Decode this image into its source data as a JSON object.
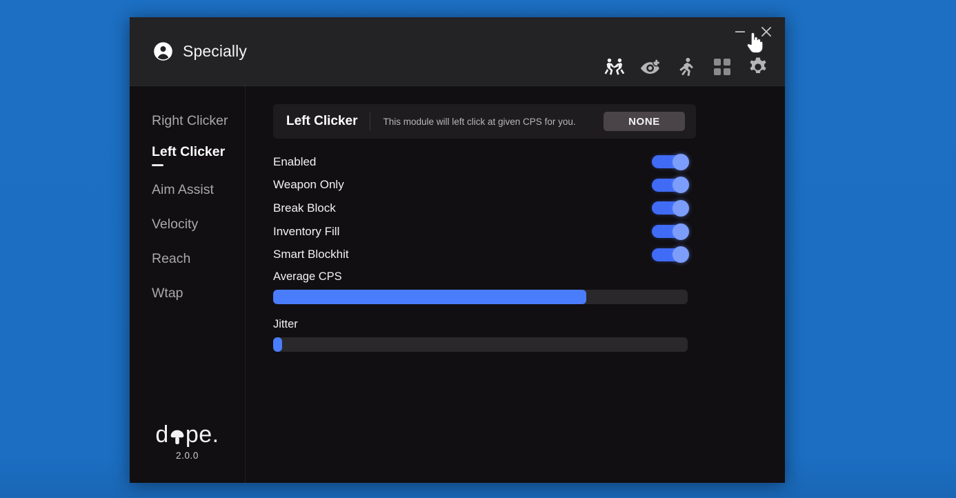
{
  "window": {
    "title": "Specially",
    "avatar_icon": "user-circle-icon",
    "minimize_label": "−",
    "close_label": "✕"
  },
  "nav_icons": [
    {
      "name": "combat-icon",
      "label": "Combat"
    },
    {
      "name": "eye-plus-icon",
      "label": "Visuals"
    },
    {
      "name": "running-person-icon",
      "label": "Movement"
    },
    {
      "name": "grid-squares-icon",
      "label": "Modules"
    },
    {
      "name": "gear-icon",
      "label": "Settings"
    }
  ],
  "sidebar": {
    "items": [
      {
        "label": "Right Clicker",
        "active": false
      },
      {
        "label": "Left Clicker",
        "active": true
      },
      {
        "label": "Aim Assist",
        "active": false
      },
      {
        "label": "Velocity",
        "active": false
      },
      {
        "label": "Reach",
        "active": false
      },
      {
        "label": "Wtap",
        "active": false
      }
    ],
    "logo": {
      "prefix": "d",
      "glyph_icon": "mushroom-icon",
      "suffix": "pe.",
      "version": "2.0.0"
    }
  },
  "module": {
    "name": "Left Clicker",
    "description": "This module will left click at given CPS for you.",
    "keybind": "NONE"
  },
  "toggles": [
    {
      "label": "Enabled",
      "on": true
    },
    {
      "label": "Weapon Only",
      "on": true
    },
    {
      "label": "Break Block",
      "on": true
    },
    {
      "label": "Inventory Fill",
      "on": true
    },
    {
      "label": "Smart Blockhit",
      "on": true
    }
  ],
  "sliders": [
    {
      "label": "Average CPS",
      "percent": 75.5
    },
    {
      "label": "Jitter",
      "percent": 2.2
    }
  ],
  "colors": {
    "desktop_blue": "#1b6ec2",
    "window_bg": "#110f11",
    "titlebar_bg": "#232224",
    "accent_blue": "#4a7dfb",
    "toggle_track": "#3f6bf5",
    "toggle_knob": "#7d9dfb",
    "keybind_bg": "#4a4449"
  }
}
